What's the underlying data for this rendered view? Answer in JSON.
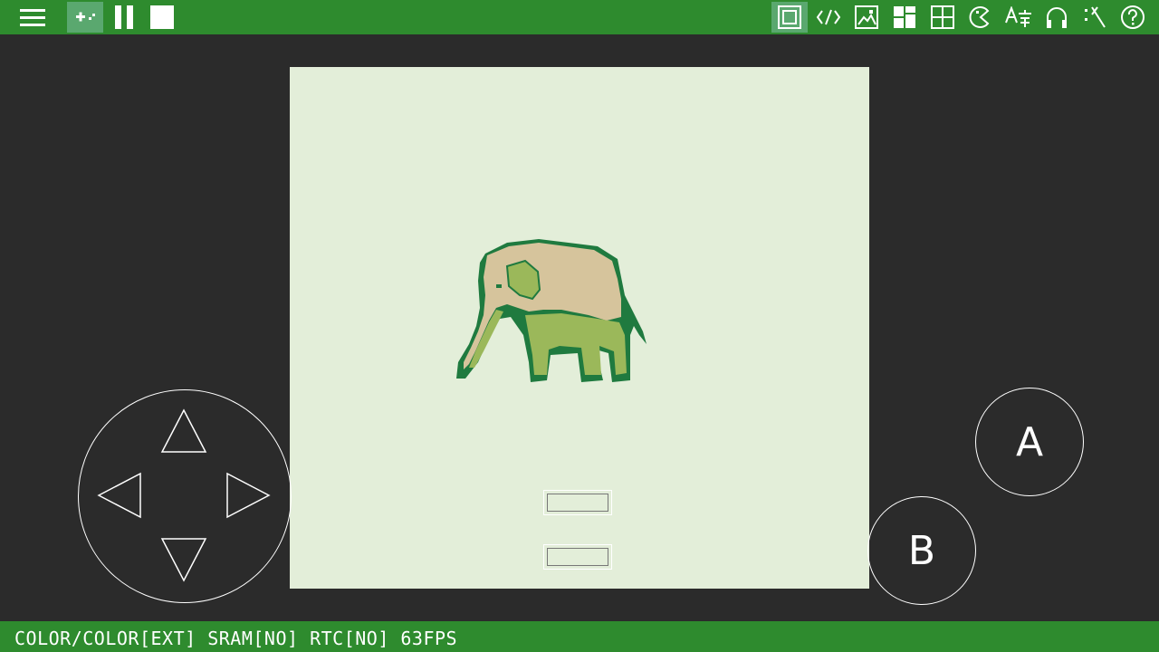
{
  "toolbar": {
    "left_icons": [
      "menu-icon",
      "gamepad-icon",
      "pause-icon",
      "stop-icon"
    ],
    "right_icons": [
      "screen-icon",
      "code-icon",
      "image-icon",
      "layout-icon",
      "grid-icon",
      "pacman-icon",
      "translate-icon",
      "headphones-icon",
      "cheat-icon",
      "help-icon"
    ],
    "active_left": "gamepad-icon",
    "active_right": "screen-icon"
  },
  "controls": {
    "button_a": "A",
    "button_b": "B",
    "dpad_icons": [
      "up-arrow-icon",
      "left-arrow-icon",
      "right-arrow-icon",
      "down-arrow-icon"
    ]
  },
  "status": {
    "text": "COLOR/COLOR[EXT] SRAM[NO] RTC[NO] 63FPS"
  },
  "colors": {
    "bar": "#2e8b2e",
    "background": "#2b2b2b",
    "screen": "#e3eed9",
    "active": "#5aa86f"
  }
}
